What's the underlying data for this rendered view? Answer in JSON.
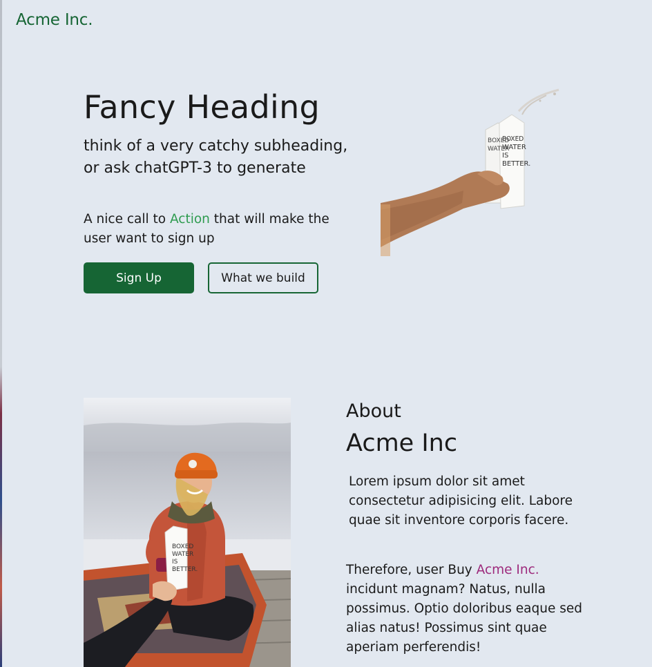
{
  "header": {
    "brand": "Acme Inc."
  },
  "hero": {
    "title": "Fancy Heading",
    "subtitle": "think of a very catchy subheading, or ask chatGPT-3 to generate",
    "cta_before": "A nice call to ",
    "cta_accent": "Action",
    "cta_after": " that will make the user want to sign up",
    "primary_button": "Sign Up",
    "secondary_button": "What we build",
    "image_alt": "Hand holding two Boxed Water cartons",
    "carton_text": [
      "BOXED",
      "WATER",
      "IS",
      "BETTER."
    ]
  },
  "about": {
    "label": "About",
    "title": "Acme Inc",
    "paragraph1": "Lorem ipsum dolor sit amet consectetur adipisicing elit. Labore quae sit inventore corporis facere.",
    "paragraph2_before": "Therefore, user Buy ",
    "paragraph2_link": "Acme Inc.",
    "paragraph2_after": " incidunt magnam? Natus, nulla possimus. Optio doloribus eaque sed alias natus! Possimus sint quae aperiam perferendis!",
    "image_alt": "Woman in orange beanie receiving a Boxed Water carton"
  },
  "colors": {
    "background": "#e2e8f0",
    "brand_green": "#166534",
    "accent_green": "#2e9b4f",
    "link_magenta": "#9d2a7c"
  }
}
